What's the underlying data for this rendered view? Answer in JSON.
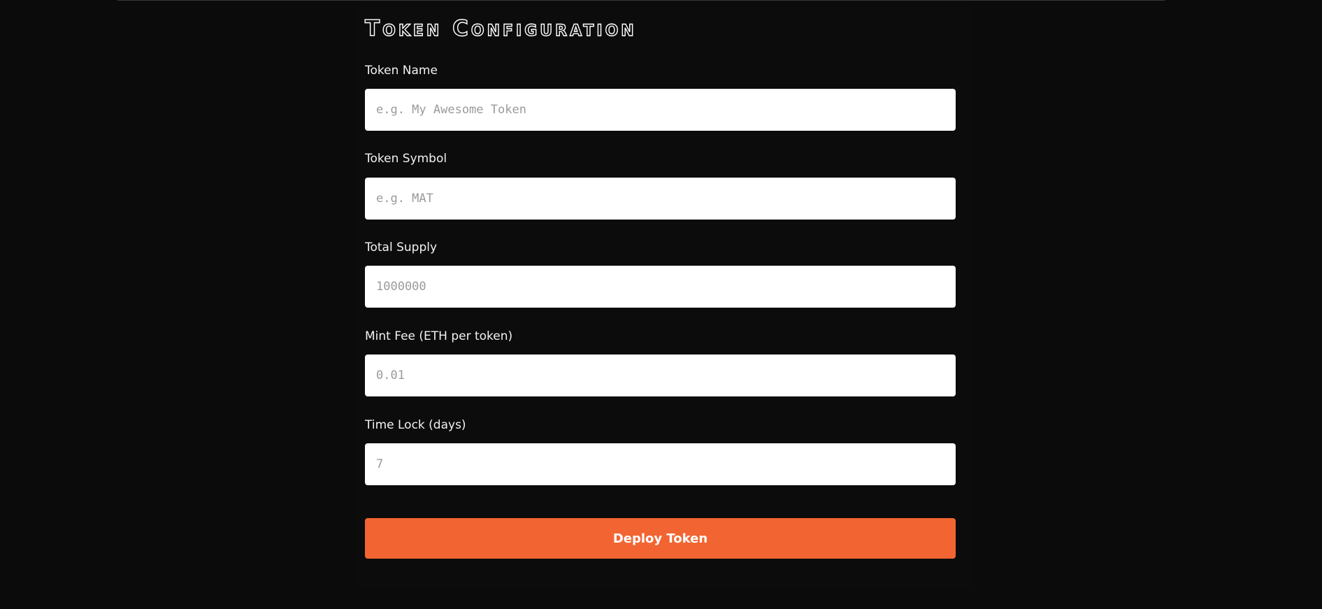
{
  "form": {
    "title": "Token Configuration",
    "fields": [
      {
        "label": "Token Name",
        "value": "",
        "placeholder": "e.g. My Awesome Token"
      },
      {
        "label": "Token Symbol",
        "value": "",
        "placeholder": "e.g. MAT"
      },
      {
        "label": "Total Supply",
        "value": "",
        "placeholder": "1000000"
      },
      {
        "label": "Mint Fee (ETH per token)",
        "value": "",
        "placeholder": "0.01"
      },
      {
        "label": "Time Lock (days)",
        "value": "",
        "placeholder": "7"
      }
    ],
    "submit_label": "Deploy Token"
  },
  "colors": {
    "background": "#0b0b0b",
    "input_background": "#ffffff",
    "placeholder": "#9a9a9a",
    "label_text": "#f2f2f2",
    "accent": "#f26532"
  }
}
